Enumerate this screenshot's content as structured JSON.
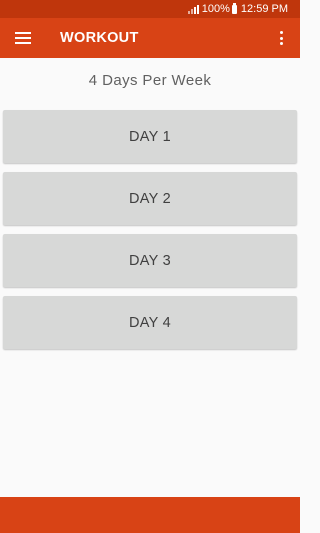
{
  "status_bar": {
    "battery": "100%",
    "time": "12:59 PM",
    "icons": [
      "signal-icon",
      "battery-icon"
    ]
  },
  "app_bar": {
    "title": "WORKOUT",
    "icons": [
      "menu-icon",
      "overflow-menu-icon"
    ]
  },
  "main": {
    "subtitle": "4 Days Per Week",
    "days": [
      {
        "label": "DAY 1"
      },
      {
        "label": "DAY 2"
      },
      {
        "label": "DAY 3"
      },
      {
        "label": "DAY 4"
      }
    ]
  },
  "colors": {
    "primary": "#d84315",
    "primary_dark": "#bf360c",
    "button_bg": "#d7d8d7",
    "background": "#fafafa"
  }
}
